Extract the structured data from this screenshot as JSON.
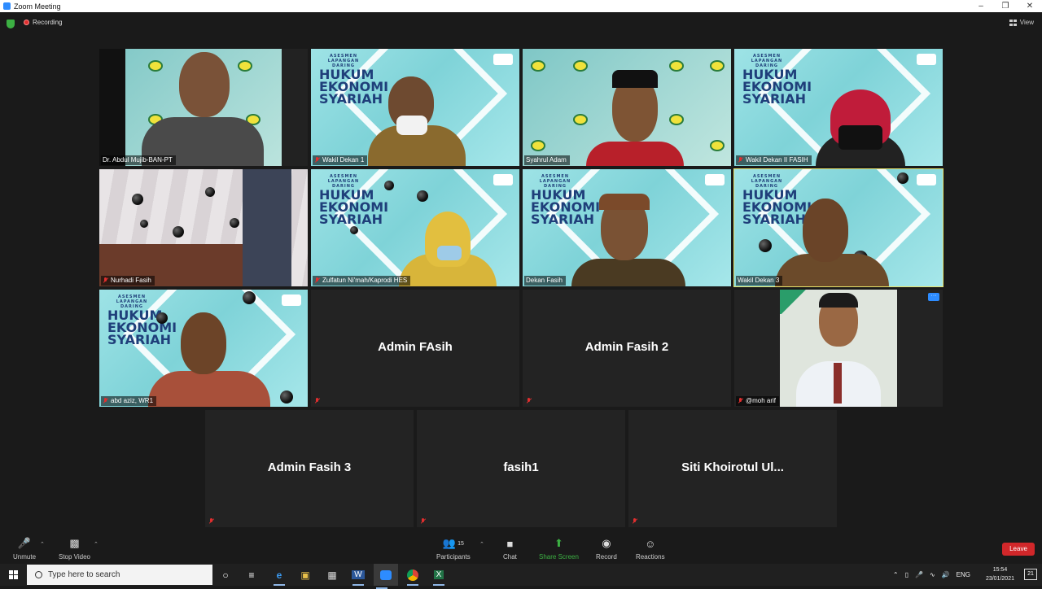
{
  "window": {
    "title": "Zoom Meeting"
  },
  "topbar": {
    "recording_label": "Recording",
    "view_label": "View"
  },
  "participants": [
    {
      "name": "Dr. Abdul Mujib-BAN-PT"
    },
    {
      "name": "Wakil Dekan 1"
    },
    {
      "name": "Syahrul Adam"
    },
    {
      "name": "Wakil Dekan II FASIH"
    },
    {
      "name": "Nurhadi Fasih"
    },
    {
      "name": "Zulfatun Ni'mah/Kaprodi HES"
    },
    {
      "name": "Dekan Fasih"
    },
    {
      "name": "Wakil Dekan 3"
    },
    {
      "name": "abd aziz, WR1"
    },
    {
      "name": "Admin FAsih",
      "display": "Admin FAsih"
    },
    {
      "name": "Admin Fasih 2",
      "display": "Admin Fasih 2"
    },
    {
      "name": "@moh arif"
    },
    {
      "name": "Admin Fasih 3",
      "display": "Admin Fasih 3"
    },
    {
      "name": "fasih1",
      "display": "fasih1"
    },
    {
      "name": "Siti Khoirotul Ul...",
      "display": "Siti Khoirotul Ul..."
    }
  ],
  "banner": {
    "small": "ASESMEN LAPANGAN DARING",
    "line1": "HUKUM",
    "line2": "EKONOMI",
    "line3": "SYARIAH"
  },
  "toolbar": {
    "unmute": "Unmute",
    "stop_video": "Stop Video",
    "participants": "Participants",
    "participants_count": "15",
    "chat": "Chat",
    "share_screen": "Share Screen",
    "record": "Record",
    "reactions": "Reactions",
    "leave": "Leave"
  },
  "taskbar": {
    "search_placeholder": "Type here to search",
    "language": "ENG",
    "time": "15:54",
    "date": "23/01/2021",
    "notification_count": "21"
  }
}
